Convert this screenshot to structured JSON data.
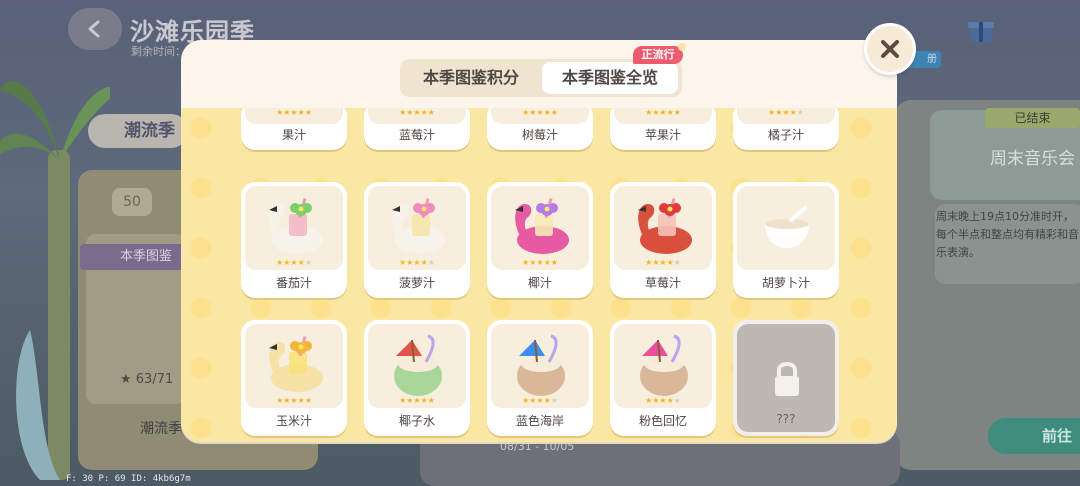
{
  "background": {
    "title": "沙滩乐园季",
    "subtitle": "剩余时间：",
    "left_tag": "潮流季",
    "left_num": "50",
    "left_tujian": "本季图鉴",
    "left_score": "★ 63/71",
    "left_bottom": "潮流季",
    "right_badge": "册",
    "right_status": "已结束",
    "right_event_title": "周末音乐会",
    "right_event_desc": "周末晚上19点10分准时开，每个半点和整点均有精彩和音乐表演。",
    "right_go": "前往",
    "bottom_date": "08/31 - 10/05"
  },
  "debug": "F: 30    P: 69    ID: 4kb6g7m",
  "modal": {
    "tabs": [
      {
        "label": "本季图鉴积分",
        "active": false
      },
      {
        "label": "本季图鉴全览",
        "active": true
      }
    ],
    "hot_badge": "正流行",
    "rows": [
      [
        {
          "name": "果汁",
          "stars": 5,
          "max": 5
        },
        {
          "name": "蓝莓汁",
          "stars": 5,
          "max": 5
        },
        {
          "name": "树莓汁",
          "stars": 5,
          "max": 5
        },
        {
          "name": "苹果汁",
          "stars": 5,
          "max": 5
        },
        {
          "name": "橘子汁",
          "stars": 4,
          "max": 5
        }
      ],
      [
        {
          "name": "番茄汁",
          "stars": 4,
          "max": 5,
          "art": "flamingo-white-green"
        },
        {
          "name": "菠萝汁",
          "stars": 4,
          "max": 5,
          "art": "flamingo-white-pink"
        },
        {
          "name": "椰汁",
          "stars": 5,
          "max": 5,
          "art": "flamingo-pink-purple"
        },
        {
          "name": "草莓汁",
          "stars": 4,
          "max": 5,
          "art": "flamingo-red"
        },
        {
          "name": "胡萝卜汁",
          "stars": 0,
          "max": 0,
          "art": "bowl"
        }
      ],
      [
        {
          "name": "玉米汁",
          "stars": 5,
          "max": 5,
          "art": "flamingo-yellow"
        },
        {
          "name": "椰子水",
          "stars": 5,
          "max": 5,
          "art": "coconut-green"
        },
        {
          "name": "蓝色海岸",
          "stars": 4,
          "max": 5,
          "art": "coconut-blue"
        },
        {
          "name": "粉色回忆",
          "stars": 4,
          "max": 5,
          "art": "coconut-pink"
        },
        {
          "name": "???",
          "stars": 0,
          "max": 0,
          "art": "lock",
          "locked": true
        }
      ]
    ]
  }
}
